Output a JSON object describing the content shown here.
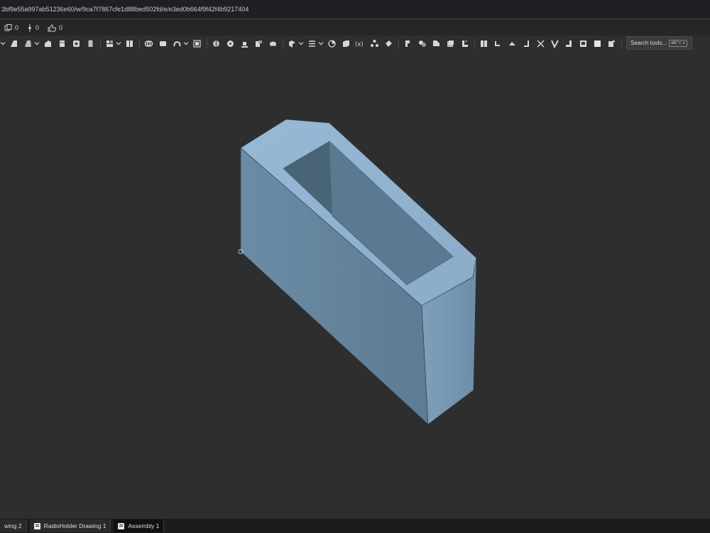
{
  "browser": {
    "url": "3bf9e55a997ab51236e60/w/9ca7f7867cfe1d88bed502fd/e/e3ed0b664f9f42f4b9217404"
  },
  "status": {
    "files_count": "0",
    "versions_count": "0",
    "likes_count": "0"
  },
  "toolbar": {
    "search_placeholder": "Search tools...",
    "search_shortcut": "alt/⌥ c",
    "tool_icons": [
      "sketch-icon",
      "extrude-icon",
      "revolve-icon",
      "sweep-icon",
      "loft-icon",
      "thicken-icon",
      "hole-icon",
      "fillet-icon",
      "chamfer-icon",
      "draft-icon",
      "shell-icon",
      "rib-icon",
      "boolean-icon",
      "split-icon",
      "transform-icon",
      "pattern-icon",
      "mirror-icon",
      "plane-icon",
      "variable-icon",
      "measure-icon",
      "sheetmetal-icon",
      "surface-icon",
      "frame-icon",
      "weld-icon",
      "tab-icon",
      "bend-icon",
      "flange-icon"
    ]
  },
  "viewport": {
    "part_color": "#8fb0cc",
    "part_shade": "#5e7b93",
    "part_side": "#6f90aa"
  },
  "tabs": [
    {
      "label": "wing 2"
    },
    {
      "label": "RadioHolder Drawing 1"
    },
    {
      "label": "Assembly 1"
    }
  ]
}
